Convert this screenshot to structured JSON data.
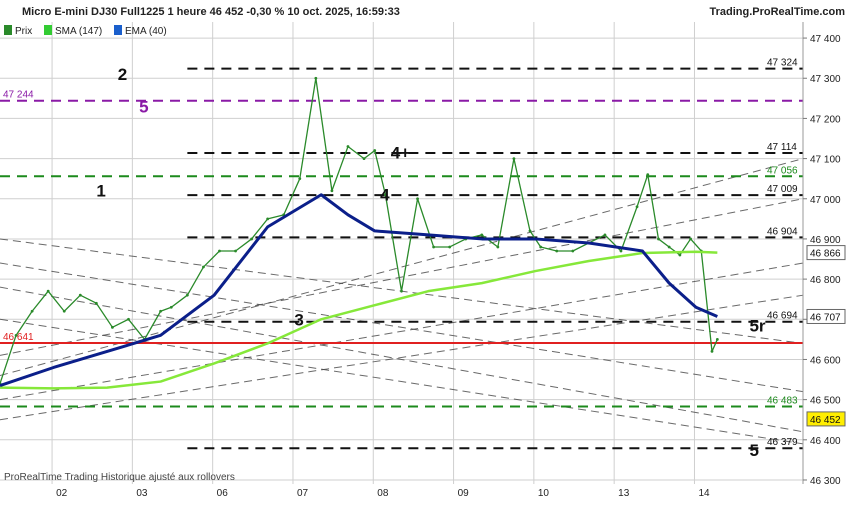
{
  "header": {
    "title": "Micro E-mini DJ30 Full1225 1 heure 46 452 -0,30 % 10 oct. 2025, 16:59:33",
    "brand": "Trading.ProRealTime.com"
  },
  "legend": [
    {
      "label": "Prix",
      "color": "#2a8a2a"
    },
    {
      "label": "SMA (147)",
      "color": "#33cc33"
    },
    {
      "label": "EMA (40)",
      "color": "#1a5fcc"
    }
  ],
  "footer": "ProRealTime Trading  Historique ajusté aux rollovers",
  "colors": {
    "price": "#2a8a2a",
    "sma": "#86e83a",
    "ema_light": "#5bb8f0",
    "ema_dark": "#0b1f8a",
    "grid": "#cfcfcf",
    "hline_dark": "#111111",
    "hline_green": "#1c8a1c",
    "hline_purple": "#8a1aa6",
    "hline_red": "#e02020",
    "trend": "#444444"
  },
  "chart_data": {
    "type": "line",
    "xlabel": "",
    "ylabel": "",
    "ylim": [
      46290,
      47440
    ],
    "x_ticks": [
      "02",
      "03",
      "06",
      "07",
      "08",
      "09",
      "10",
      "13",
      "14"
    ],
    "y_ticks": [
      46300,
      46400,
      46500,
      46600,
      46700,
      46800,
      46900,
      47000,
      47100,
      47200,
      47300,
      47400
    ],
    "grid": true,
    "legend_position": "top-left",
    "series": [
      {
        "name": "Prix",
        "x": [
          0,
          0.3,
          0.6,
          0.9,
          1.2,
          1.5,
          1.8,
          2.1,
          2.4,
          2.7,
          3.0,
          3.2,
          3.5,
          3.8,
          4.1,
          4.4,
          4.7,
          5.0,
          5.3,
          5.6,
          5.9,
          6.2,
          6.5,
          6.8,
          7.0,
          7.2,
          7.5,
          7.8,
          8.1,
          8.4,
          8.7,
          9.0,
          9.3,
          9.6,
          9.9,
          10.1,
          10.4,
          10.7,
          11.0,
          11.3,
          11.6,
          11.9,
          12.1,
          12.3,
          12.5,
          12.7,
          12.9,
          13.1,
          13.3,
          13.4
        ],
        "values": [
          46540,
          46660,
          46720,
          46770,
          46720,
          46760,
          46740,
          46680,
          46700,
          46650,
          46720,
          46730,
          46760,
          46830,
          46870,
          46870,
          46900,
          46950,
          46960,
          47050,
          47300,
          47020,
          47130,
          47100,
          47120,
          47010,
          46770,
          47000,
          46880,
          46880,
          46900,
          46910,
          46880,
          47100,
          46920,
          46880,
          46870,
          46870,
          46890,
          46910,
          46870,
          46980,
          47060,
          46900,
          46880,
          46860,
          46900,
          46870,
          46620,
          46650
        ]
      },
      {
        "name": "SMA (147)",
        "x": [
          0,
          1,
          2,
          3,
          4,
          5,
          6,
          7,
          8,
          9,
          10,
          11,
          12,
          13,
          13.4
        ],
        "values": [
          46530,
          46528,
          46530,
          46545,
          46590,
          46640,
          46700,
          46735,
          46770,
          46790,
          46820,
          46845,
          46865,
          46868,
          46866
        ]
      },
      {
        "name": "EMA (40)",
        "x": [
          0,
          1,
          2,
          3,
          4,
          5,
          6,
          6.5,
          7,
          8,
          9,
          10,
          11,
          12,
          12.5,
          13,
          13.4
        ],
        "values": [
          46535,
          46580,
          46620,
          46660,
          46760,
          46930,
          47010,
          46960,
          46920,
          46910,
          46900,
          46900,
          46890,
          46870,
          46790,
          46730,
          46707
        ]
      }
    ],
    "hlines": [
      {
        "value": 47324,
        "label": "47 324",
        "color": "#111111",
        "style": "dashed"
      },
      {
        "value": 47244,
        "label": "47 244",
        "color": "#8a1aa6",
        "style": "dashed"
      },
      {
        "value": 47114,
        "label": "47 114",
        "color": "#111111",
        "style": "dashed"
      },
      {
        "value": 47056,
        "label": "47 056",
        "color": "#1c8a1c",
        "style": "dashed"
      },
      {
        "value": 47009,
        "label": "47 009",
        "color": "#111111",
        "style": "dashed"
      },
      {
        "value": 46904,
        "label": "46 904",
        "color": "#111111",
        "style": "dashed"
      },
      {
        "value": 46694,
        "label": "46 694",
        "color": "#111111",
        "style": "dashed"
      },
      {
        "value": 46641,
        "label": "46 641",
        "color": "#e02020",
        "style": "solid"
      },
      {
        "value": 46483,
        "label": "46 483",
        "color": "#1c8a1c",
        "style": "dashed"
      },
      {
        "value": 46379,
        "label": "46 379",
        "color": "#111111",
        "style": "dashed"
      }
    ],
    "price_tags": [
      {
        "value": 46866,
        "label": "46 866"
      },
      {
        "value": 46707,
        "label": "46 707"
      },
      {
        "value": 46452,
        "label": "46 452"
      }
    ],
    "annotations": [
      {
        "text": "2",
        "x": 2.2,
        "value": 47310,
        "color": "#111111"
      },
      {
        "text": "5",
        "x": 2.6,
        "value": 47230,
        "color": "#8a1aa6"
      },
      {
        "text": "4+",
        "x": 7.3,
        "value": 47115,
        "color": "#111111"
      },
      {
        "text": "1",
        "x": 1.8,
        "value": 47020,
        "color": "#111111"
      },
      {
        "text": "4",
        "x": 7.1,
        "value": 47010,
        "color": "#111111"
      },
      {
        "text": "3",
        "x": 5.5,
        "value": 46700,
        "color": "#111111"
      },
      {
        "text": "5r",
        "x": 14.0,
        "value": 46685,
        "color": "#111111"
      },
      {
        "text": "5",
        "x": 14.0,
        "value": 46375,
        "color": "#111111"
      }
    ]
  }
}
